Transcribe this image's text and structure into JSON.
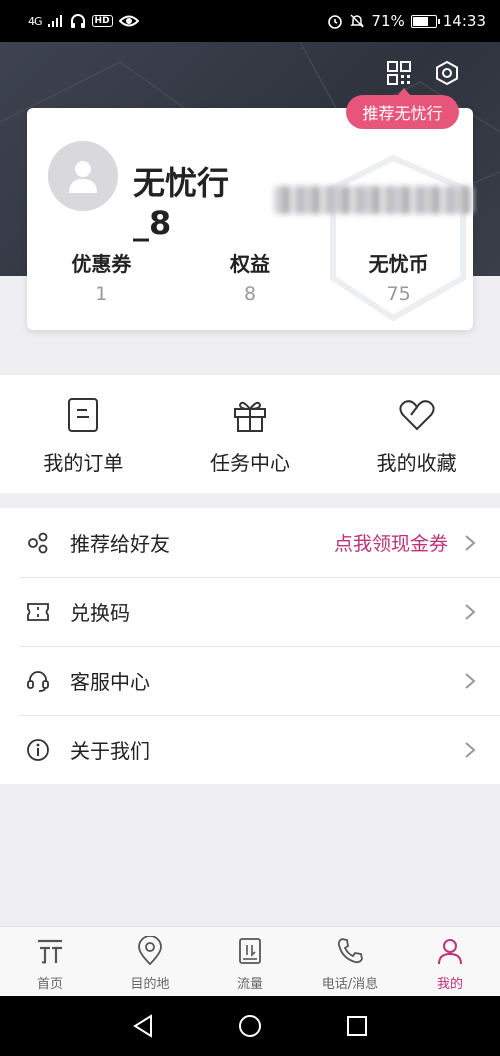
{
  "status_bar": {
    "signal": "4G",
    "hd": "HD",
    "battery_text": "71%",
    "battery_level": 0.71,
    "time": "14:33"
  },
  "header": {
    "recommend_pill": "推荐无忧行"
  },
  "profile": {
    "username": "无忧行_8",
    "stats": [
      {
        "label": "优惠券",
        "value": "1"
      },
      {
        "label": "权益",
        "value": "8"
      },
      {
        "label": "无忧币",
        "value": "75"
      }
    ]
  },
  "quick_actions": [
    {
      "label": "我的订单",
      "icon": "order-icon"
    },
    {
      "label": "任务中心",
      "icon": "gift-icon"
    },
    {
      "label": "我的收藏",
      "icon": "heart-icon"
    }
  ],
  "menu": [
    {
      "label": "推荐给好友",
      "promo": "点我领现金券",
      "icon": "share-icon"
    },
    {
      "label": "兑换码",
      "promo": "",
      "icon": "ticket-icon"
    },
    {
      "label": "客服中心",
      "promo": "",
      "icon": "headset-icon"
    },
    {
      "label": "关于我们",
      "promo": "",
      "icon": "info-icon"
    }
  ],
  "bottom_nav": [
    {
      "label": "首页",
      "icon": "home-icon",
      "active": false
    },
    {
      "label": "目的地",
      "icon": "location-icon",
      "active": false
    },
    {
      "label": "流量",
      "icon": "data-icon",
      "active": false
    },
    {
      "label": "电话/消息",
      "icon": "phone-icon",
      "active": false
    },
    {
      "label": "我的",
      "icon": "profile-icon",
      "active": true
    }
  ],
  "colors": {
    "accent": "#c0317a",
    "pill": "#e8557b",
    "header_bg": "#363a44"
  }
}
